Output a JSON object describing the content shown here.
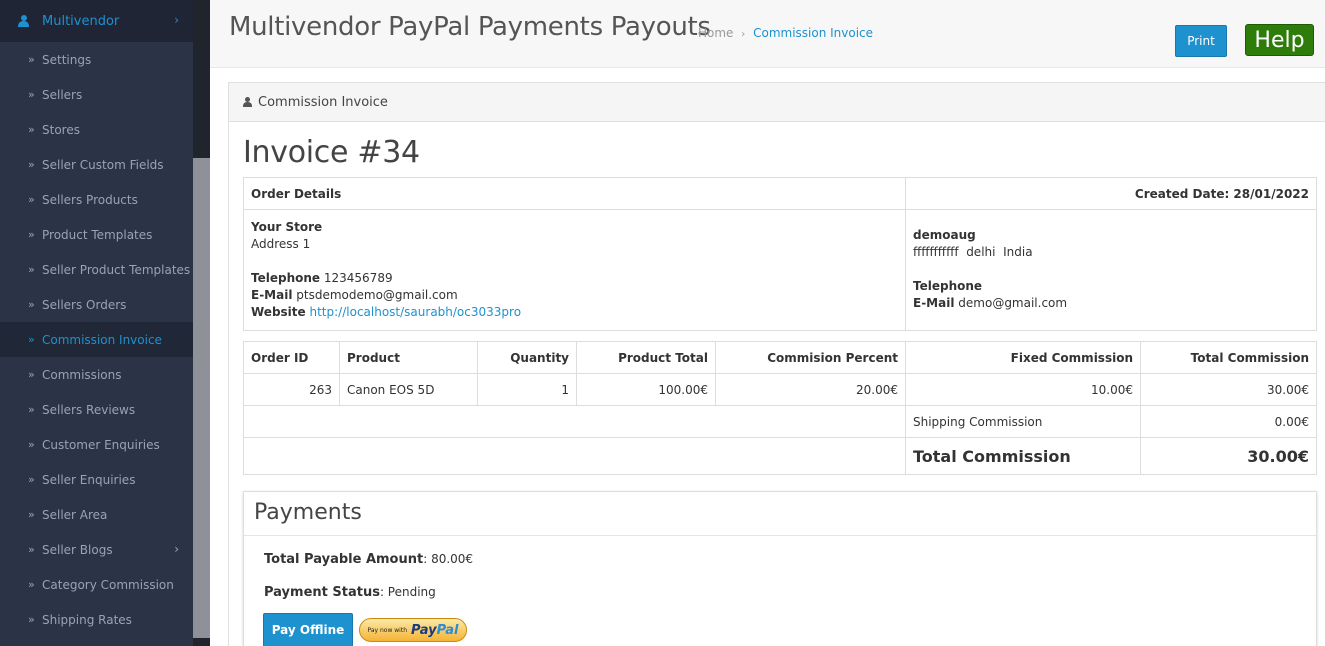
{
  "sidebar": {
    "header": "Multivendor",
    "items": [
      {
        "label": "Settings"
      },
      {
        "label": "Sellers"
      },
      {
        "label": "Stores"
      },
      {
        "label": "Seller Custom Fields"
      },
      {
        "label": "Sellers Products"
      },
      {
        "label": "Product Templates"
      },
      {
        "label": "Seller Product Templates"
      },
      {
        "label": "Sellers Orders"
      },
      {
        "label": "Commission Invoice"
      },
      {
        "label": "Commissions"
      },
      {
        "label": "Sellers Reviews"
      },
      {
        "label": "Customer Enquiries"
      },
      {
        "label": "Seller Enquiries"
      },
      {
        "label": "Seller Area"
      },
      {
        "label": "Seller Blogs"
      },
      {
        "label": "Category Commission"
      },
      {
        "label": "Shipping Rates"
      }
    ],
    "active_index": 8
  },
  "header": {
    "title": "Multivendor PayPal Payments Payouts",
    "breadcrumb_home": "Home",
    "breadcrumb_current": "Commission Invoice",
    "print_label": "Print",
    "help_label": "Help"
  },
  "panel": {
    "heading": "Commission Invoice",
    "invoice_title": "Invoice #34"
  },
  "order": {
    "details_label": "Order Details",
    "created_date": "Created Date: 28/01/2022",
    "store_name": "Your Store",
    "store_address": "Address 1",
    "telephone_label": "Telephone",
    "telephone": "123456789",
    "email_label": "E-Mail",
    "email": "ptsdemodemo@gmail.com",
    "website_label": "Website",
    "website": "http://localhost/saurabh/oc3033pro",
    "seller_name": "demoaug",
    "seller_address": "fffffffffff  delhi  India",
    "seller_telephone_label": "Telephone",
    "seller_email_label": "E-Mail",
    "seller_email": "demo@gmail.com"
  },
  "commission_table": {
    "headers": [
      "Order ID",
      "Product",
      "Quantity",
      "Product Total",
      "Commision Percent",
      "Fixed Commission",
      "Total Commission"
    ],
    "rows": [
      [
        "263",
        "Canon EOS 5D",
        "1",
        "100.00€",
        "20.00€",
        "10.00€",
        "30.00€"
      ]
    ],
    "shipping_label": "Shipping Commission",
    "shipping_value": "0.00€",
    "total_label": "Total Commission",
    "total_value": "30.00€"
  },
  "payments": {
    "title": "Payments",
    "payable_label": "Total Payable Amount",
    "payable_value": ": 80.00€",
    "status_label": "Payment Status",
    "status_value": ": Pending",
    "pay_offline_label": "Pay Offline",
    "paypal_small": "Pay now with",
    "paypal_brand_1": "Pay",
    "paypal_brand_2": "Pal"
  },
  "icons": {
    "sidebar_header": "user-icon",
    "panel_heading": "user-icon",
    "item_bullet": "double-chevron-right-icon",
    "expand": "chevron-right-icon"
  },
  "colors": {
    "accent": "#1e91cf",
    "help_green": "#2e7d0a",
    "sidebar_bg": "#2b3346"
  }
}
